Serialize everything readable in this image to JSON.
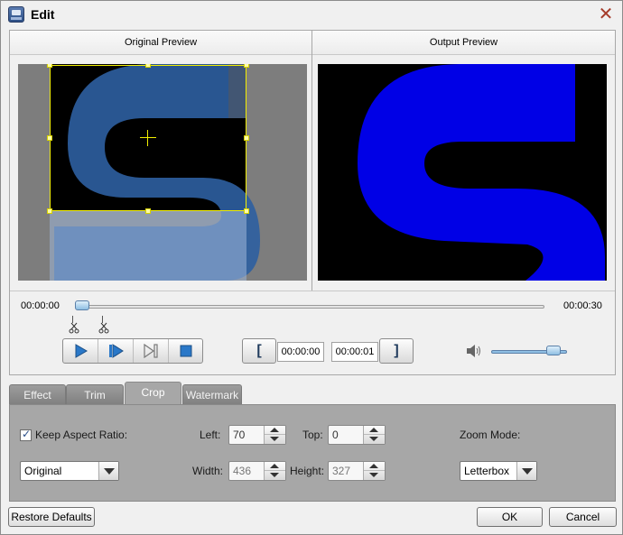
{
  "window": {
    "title": "Edit",
    "close_symbol": "✕"
  },
  "preview": {
    "original_label": "Original Preview",
    "output_label": "Output Preview"
  },
  "timeline": {
    "start_time": "00:00:00",
    "end_time": "00:00:30",
    "position_fraction": 0
  },
  "playback": {
    "mark_in_time": "00:00:00",
    "mark_out_time": "00:00:01",
    "volume_fraction": 0.9
  },
  "tabs": [
    {
      "label": "Effect"
    },
    {
      "label": "Trim"
    },
    {
      "label": "Crop"
    },
    {
      "label": "Watermark"
    }
  ],
  "active_tab": "Crop",
  "crop": {
    "keep_aspect_label": "Keep Aspect Ratio:",
    "keep_aspect_checked": true,
    "aspect_value": "Original",
    "left_label": "Left:",
    "left_value": "70",
    "top_label": "Top:",
    "top_value": "0",
    "width_label": "Width:",
    "width_value": "436",
    "height_label": "Height:",
    "height_value": "327",
    "zoom_label": "Zoom Mode:",
    "zoom_value": "Letterbox"
  },
  "footer": {
    "restore_label": "Restore Defaults",
    "ok_label": "OK",
    "cancel_label": "Cancel"
  },
  "colors": {
    "output_s": "#0000e6",
    "original_s": "#2e5fa1",
    "crop_border": "#f2ee00"
  }
}
